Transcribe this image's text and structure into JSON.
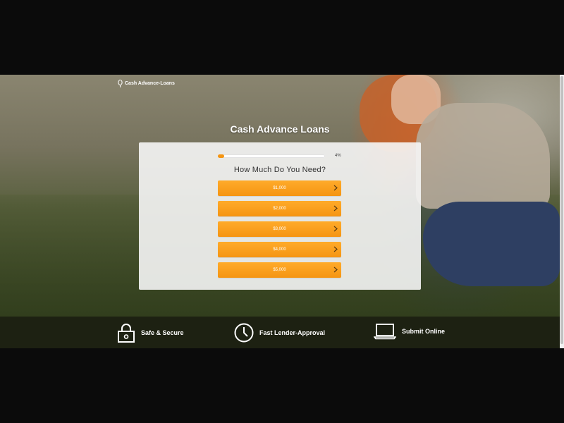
{
  "brand": {
    "logo_text": "Cash Advance-Loans"
  },
  "page": {
    "title": "Cash Advance Loans"
  },
  "form": {
    "progress_percent": 4,
    "progress_label": "4%",
    "question": "How Much Do You Need?",
    "options": [
      {
        "label": "$1,000"
      },
      {
        "label": "$2,000"
      },
      {
        "label": "$3,000"
      },
      {
        "label": "$4,000"
      },
      {
        "label": "$5,000"
      }
    ]
  },
  "features": [
    {
      "label": "Safe & Secure",
      "icon": "lock-icon"
    },
    {
      "label": "Fast Lender-Approval",
      "icon": "clock-icon"
    },
    {
      "label": "Submit Online",
      "icon": "laptop-icon"
    }
  ],
  "colors": {
    "accent": "#f59512",
    "accent_light": "#ffab2a",
    "feature_bar": "#1d2112"
  }
}
